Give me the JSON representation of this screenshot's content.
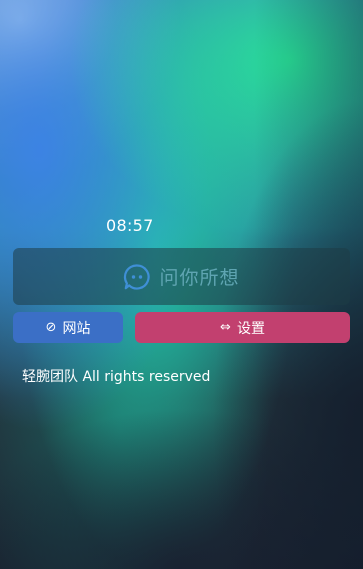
{
  "clock": {
    "time": "08:57"
  },
  "search": {
    "placeholder": "问你所想",
    "icon": "chat-bubble-icon"
  },
  "buttons": {
    "site": {
      "glyph": "⊘",
      "label": "网站",
      "color": "#3b6fc6"
    },
    "settings": {
      "glyph": "⇔",
      "label": "设置",
      "color": "#c2406f"
    }
  },
  "footer": {
    "text": "轻腕团队 All rights reserved"
  }
}
